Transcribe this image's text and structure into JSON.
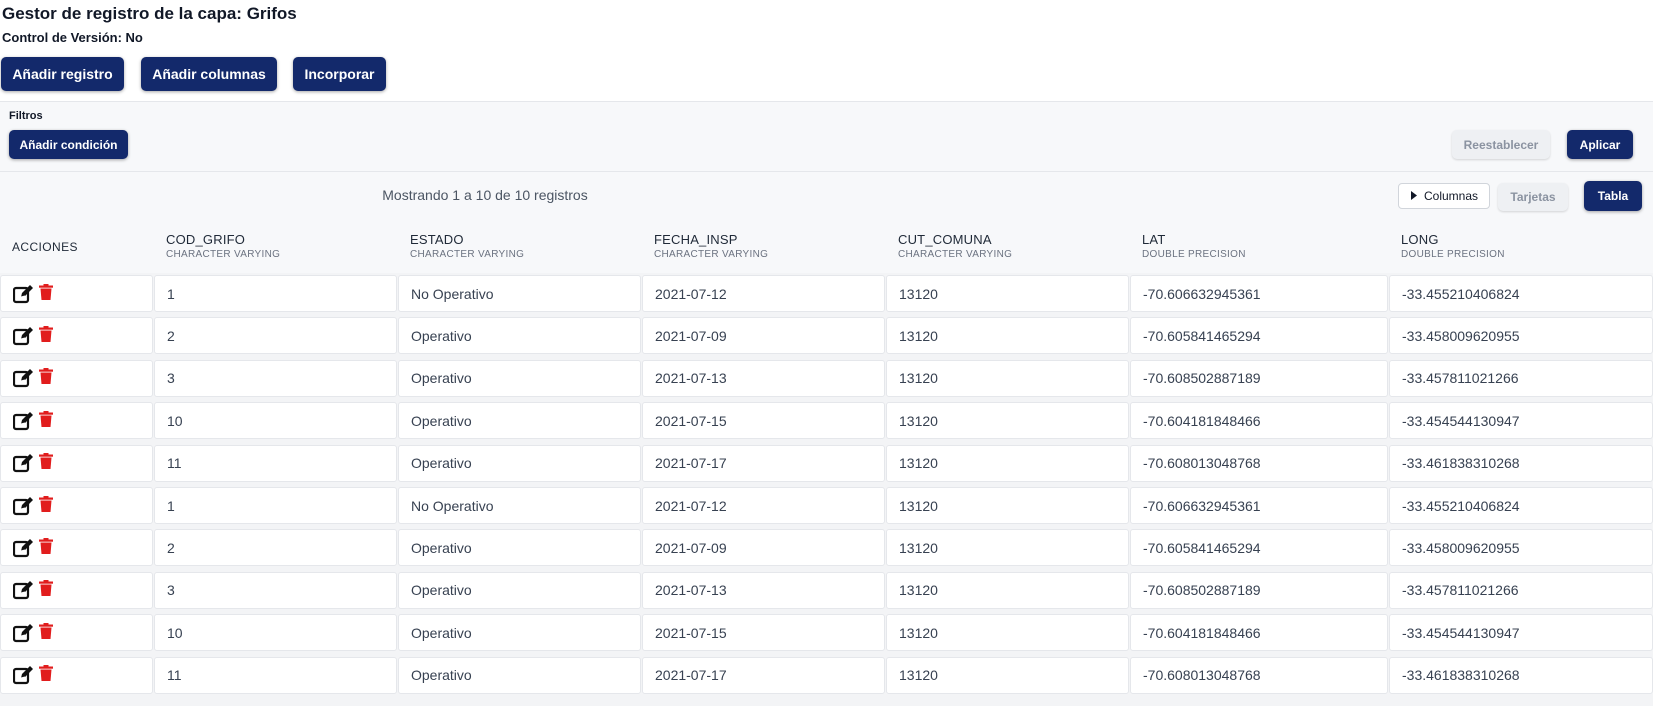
{
  "header": {
    "title": "Gestor de registro de la capa: Grifos",
    "version_label": "Control de Versión:",
    "version_value": "No"
  },
  "toolbar": {
    "add_record": "Añadir registro",
    "add_columns": "Añadir columnas",
    "incorporate": "Incorporar"
  },
  "filters": {
    "label": "Filtros",
    "add_condition": "Añadir condición",
    "reset": "Reestablecer",
    "apply": "Aplicar"
  },
  "status": {
    "text": "Mostrando 1 a 10 de 10 registros"
  },
  "view": {
    "columns": "Columnas",
    "cards": "Tarjetas",
    "table": "Tabla"
  },
  "table": {
    "actions_header": "ACCIONES",
    "columns": [
      {
        "name": "COD_GRIFO",
        "type": "CHARACTER VARYING"
      },
      {
        "name": "ESTADO",
        "type": "CHARACTER VARYING"
      },
      {
        "name": "FECHA_INSP",
        "type": "CHARACTER VARYING"
      },
      {
        "name": "CUT_COMUNA",
        "type": "CHARACTER VARYING"
      },
      {
        "name": "LAT",
        "type": "DOUBLE PRECISION"
      },
      {
        "name": "LONG",
        "type": "DOUBLE PRECISION"
      }
    ],
    "rows": [
      [
        "1",
        "No Operativo",
        "2021-07-12",
        "13120",
        "-70.606632945361",
        "-33.455210406824"
      ],
      [
        "2",
        "Operativo",
        "2021-07-09",
        "13120",
        "-70.605841465294",
        "-33.458009620955"
      ],
      [
        "3",
        "Operativo",
        "2021-07-13",
        "13120",
        "-70.608502887189",
        "-33.457811021266"
      ],
      [
        "10",
        "Operativo",
        "2021-07-15",
        "13120",
        "-70.604181848466",
        "-33.454544130947"
      ],
      [
        "11",
        "Operativo",
        "2021-07-17",
        "13120",
        "-70.608013048768",
        "-33.461838310268"
      ],
      [
        "1",
        "No Operativo",
        "2021-07-12",
        "13120",
        "-70.606632945361",
        "-33.455210406824"
      ],
      [
        "2",
        "Operativo",
        "2021-07-09",
        "13120",
        "-70.605841465294",
        "-33.458009620955"
      ],
      [
        "3",
        "Operativo",
        "2021-07-13",
        "13120",
        "-70.608502887189",
        "-33.457811021266"
      ],
      [
        "10",
        "Operativo",
        "2021-07-15",
        "13120",
        "-70.604181848466",
        "-33.454544130947"
      ],
      [
        "11",
        "Operativo",
        "2021-07-17",
        "13120",
        "-70.608013048768",
        "-33.461838310268"
      ]
    ]
  },
  "icons": {
    "edit": "edit-icon",
    "delete": "trash-icon",
    "expand": "caret-right-icon"
  },
  "colors": {
    "primary": "#13296b",
    "danger": "#e11d1d"
  }
}
